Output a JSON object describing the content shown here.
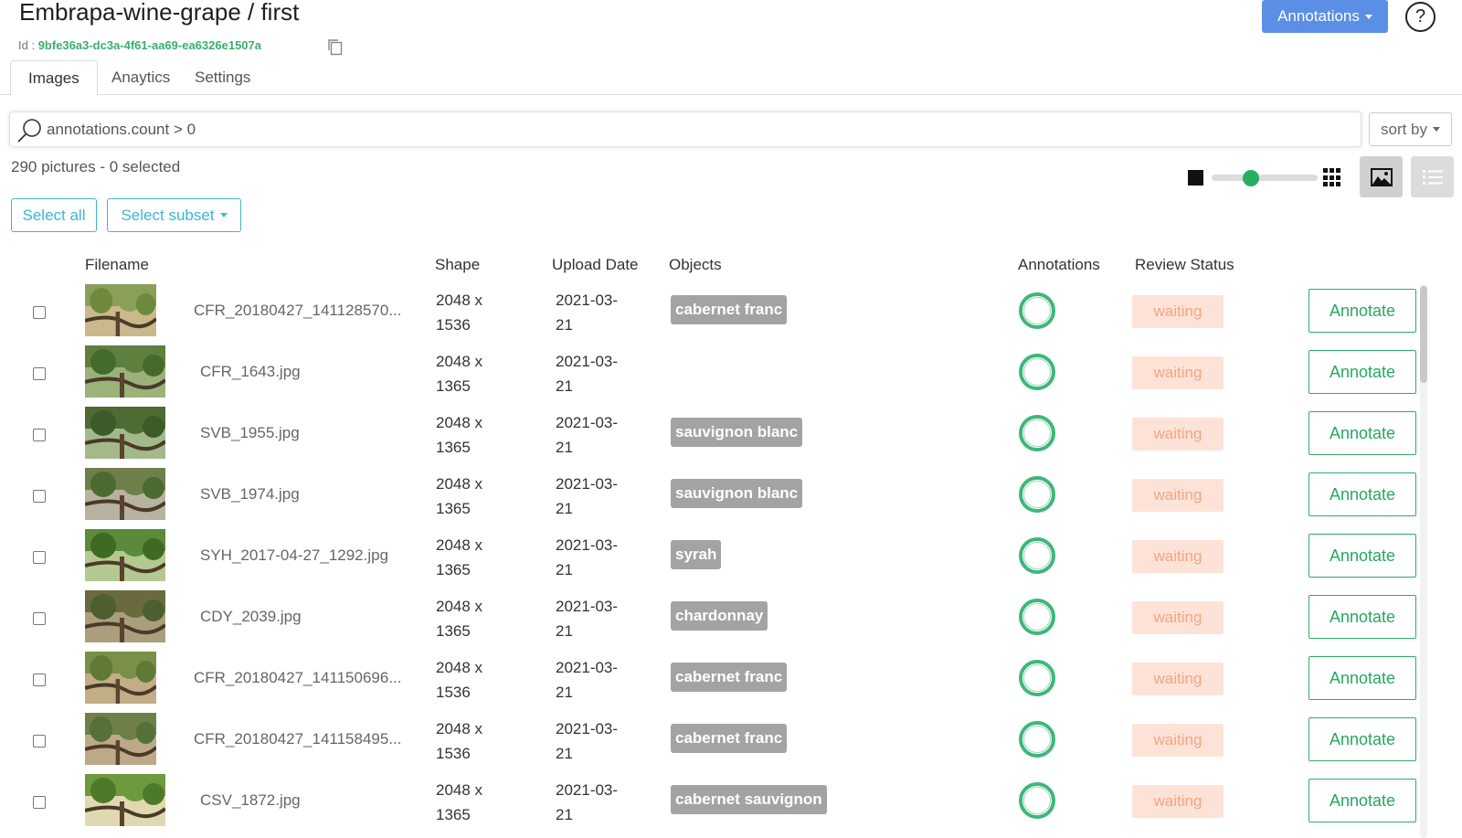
{
  "header": {
    "title": "Embrapa-wine-grape / first",
    "id_label": "Id : ",
    "id_value": "9bfe36a3-dc3a-4f61-aa69-ea6326e1507a",
    "annotations_button": "Annotations",
    "help_symbol": "?"
  },
  "tabs": [
    {
      "label": "Images",
      "active": true
    },
    {
      "label": "Anaytics",
      "active": false
    },
    {
      "label": "Settings",
      "active": false
    }
  ],
  "search": {
    "value": "annotations.count > 0"
  },
  "sort": {
    "label": "sort by"
  },
  "summary": {
    "text": "290 pictures - 0 selected"
  },
  "thumbnail_size": {
    "level": 0.35
  },
  "selection": {
    "select_all": "Select all",
    "select_subset": "Select subset"
  },
  "table": {
    "columns": {
      "filename": "Filename",
      "shape": "Shape",
      "upload_date": "Upload Date",
      "objects": "Objects",
      "annotations": "Annotations",
      "review_status": "Review Status"
    },
    "annotate_label": "Annotate",
    "rows": [
      {
        "filename": "CFR_20180427_141128570...",
        "shape_1": "2048 x",
        "shape_2": "1536",
        "date_1": "2021-03-",
        "date_2": "21",
        "object": "cabernet franc",
        "status": "waiting"
      },
      {
        "filename": "CFR_1643.jpg",
        "shape_1": "2048 x",
        "shape_2": "1365",
        "date_1": "2021-03-",
        "date_2": "21",
        "object": "",
        "status": "waiting"
      },
      {
        "filename": "SVB_1955.jpg",
        "shape_1": "2048 x",
        "shape_2": "1365",
        "date_1": "2021-03-",
        "date_2": "21",
        "object": "sauvignon blanc",
        "status": "waiting"
      },
      {
        "filename": "SVB_1974.jpg",
        "shape_1": "2048 x",
        "shape_2": "1365",
        "date_1": "2021-03-",
        "date_2": "21",
        "object": "sauvignon blanc",
        "status": "waiting"
      },
      {
        "filename": "SYH_2017-04-27_1292.jpg",
        "shape_1": "2048 x",
        "shape_2": "1365",
        "date_1": "2021-03-",
        "date_2": "21",
        "object": "syrah",
        "status": "waiting"
      },
      {
        "filename": "CDY_2039.jpg",
        "shape_1": "2048 x",
        "shape_2": "1365",
        "date_1": "2021-03-",
        "date_2": "21",
        "object": "chardonnay",
        "status": "waiting"
      },
      {
        "filename": "CFR_20180427_141150696...",
        "shape_1": "2048 x",
        "shape_2": "1536",
        "date_1": "2021-03-",
        "date_2": "21",
        "object": "cabernet franc",
        "status": "waiting"
      },
      {
        "filename": "CFR_20180427_141158495...",
        "shape_1": "2048 x",
        "shape_2": "1536",
        "date_1": "2021-03-",
        "date_2": "21",
        "object": "cabernet franc",
        "status": "waiting"
      },
      {
        "filename": "CSV_1872.jpg",
        "shape_1": "2048 x",
        "shape_2": "1365",
        "date_1": "2021-03-",
        "date_2": "21",
        "object": "cabernet sauvignon",
        "status": "waiting"
      }
    ]
  },
  "colors": {
    "primary": "#5b8fe6",
    "accent_green": "#27a85f",
    "info_outline": "#3fb4d6",
    "waiting_bg": "#fde3d7",
    "waiting_text": "#f4a582",
    "object_tag": "#a3a3a3"
  },
  "icons": {
    "copy": "copy-icon",
    "search": "search-icon",
    "help": "help-icon",
    "image_view": "image-view-icon",
    "list_view": "list-view-icon",
    "grid": "grid-icon"
  }
}
